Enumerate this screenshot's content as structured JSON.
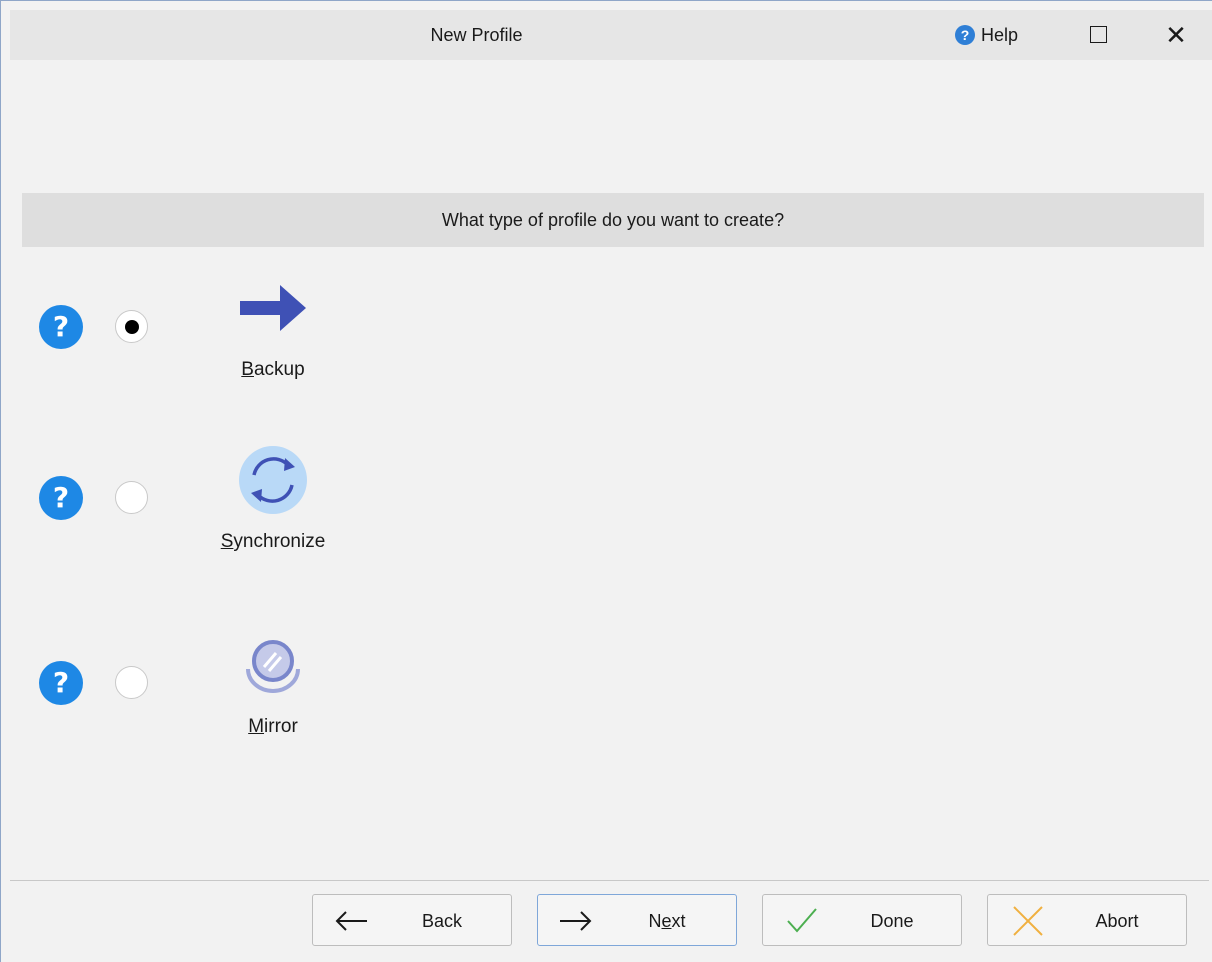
{
  "window": {
    "title": "New Profile",
    "help_label": "Help"
  },
  "banner": {
    "question": "What type of profile do you want to create?"
  },
  "options": [
    {
      "label_underline": "B",
      "label_rest": "ackup",
      "selected": true,
      "icon": "arrow-right-icon"
    },
    {
      "label_underline": "S",
      "label_rest": "ynchronize",
      "selected": false,
      "icon": "sync-icon"
    },
    {
      "label_underline": "M",
      "label_rest": "irror",
      "selected": false,
      "icon": "mirror-icon"
    }
  ],
  "buttons": {
    "back": {
      "label": "Back",
      "icon": "arrow-left-icon"
    },
    "next": {
      "label_pre": "N",
      "label_underline": "e",
      "label_post": "xt",
      "icon": "arrow-right-icon"
    },
    "done": {
      "label": "Done",
      "icon": "checkmark-icon"
    },
    "abort": {
      "label": "Abort",
      "icon": "cross-icon"
    }
  },
  "colors": {
    "accent_blue": "#1e88e5",
    "backup_arrow": "#3f51b5",
    "done_check": "#4caf50",
    "abort_cross": "#f0b040"
  }
}
